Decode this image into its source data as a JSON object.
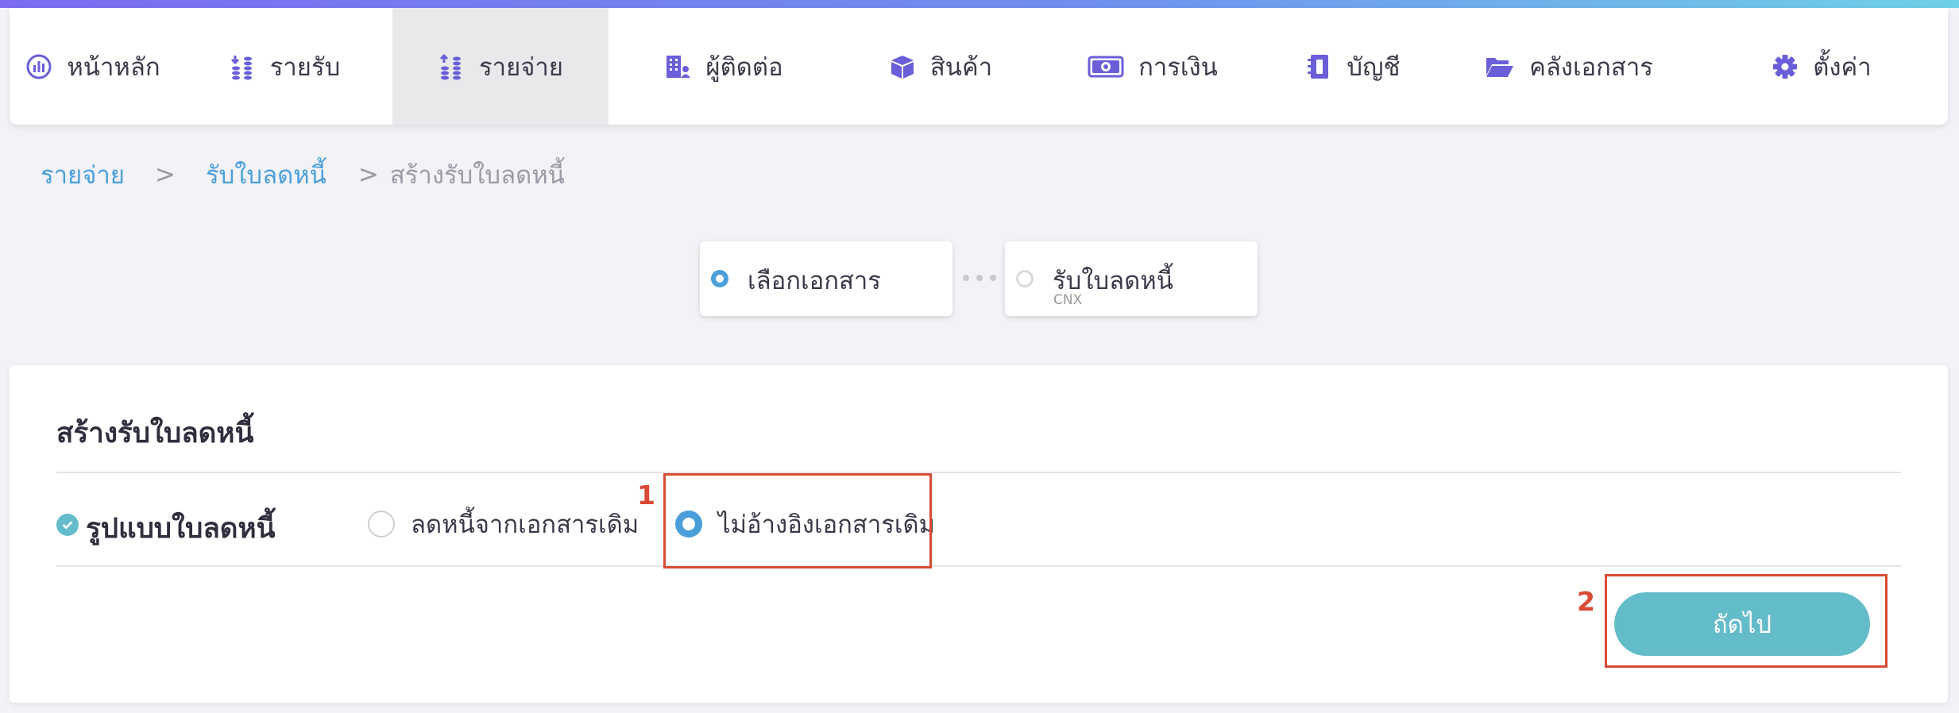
{
  "nav": {
    "items": [
      {
        "label": "หน้าหลัก",
        "icon": "dashboard-gauge-icon"
      },
      {
        "label": "รายรับ",
        "icon": "income-coins-icon"
      },
      {
        "label": "รายจ่าย",
        "icon": "expense-coins-icon",
        "active": true
      },
      {
        "label": "ผู้ติดต่อ",
        "icon": "contacts-building-icon"
      },
      {
        "label": "สินค้า",
        "icon": "product-box-icon"
      },
      {
        "label": "การเงิน",
        "icon": "money-bill-icon"
      },
      {
        "label": "บัญชี",
        "icon": "account-book-icon"
      },
      {
        "label": "คลังเอกสาร",
        "icon": "folder-open-icon"
      },
      {
        "label": "ตั้งค่า",
        "icon": "gear-icon"
      }
    ]
  },
  "breadcrumb": {
    "items": [
      "รายจ่าย",
      "รับใบลดหนี้",
      "สร้างรับใบลดหนี้"
    ],
    "separator": ">"
  },
  "stepper": {
    "steps": [
      {
        "label": "เลือกเอกสาร",
        "sub": "",
        "active": true
      },
      {
        "label": "รับใบลดหนี้",
        "sub": "CNX",
        "active": false
      }
    ]
  },
  "form": {
    "title": "สร้างรับใบลดหนี้",
    "field_label": "รูปแบบใบลดหนี้",
    "options": [
      {
        "label": "ลดหนี้จากเอกสารเดิม",
        "selected": false
      },
      {
        "label": "ไม่อ้างอิงเอกสารเดิม",
        "selected": true
      }
    ],
    "next_label": "ถัดไป"
  },
  "annotations": {
    "labels": [
      "1",
      "2"
    ],
    "color": "#d94a35"
  },
  "colors": {
    "accent": "#4a9fdb",
    "button": "#63bcc9",
    "icon": "#6a5fd8"
  }
}
